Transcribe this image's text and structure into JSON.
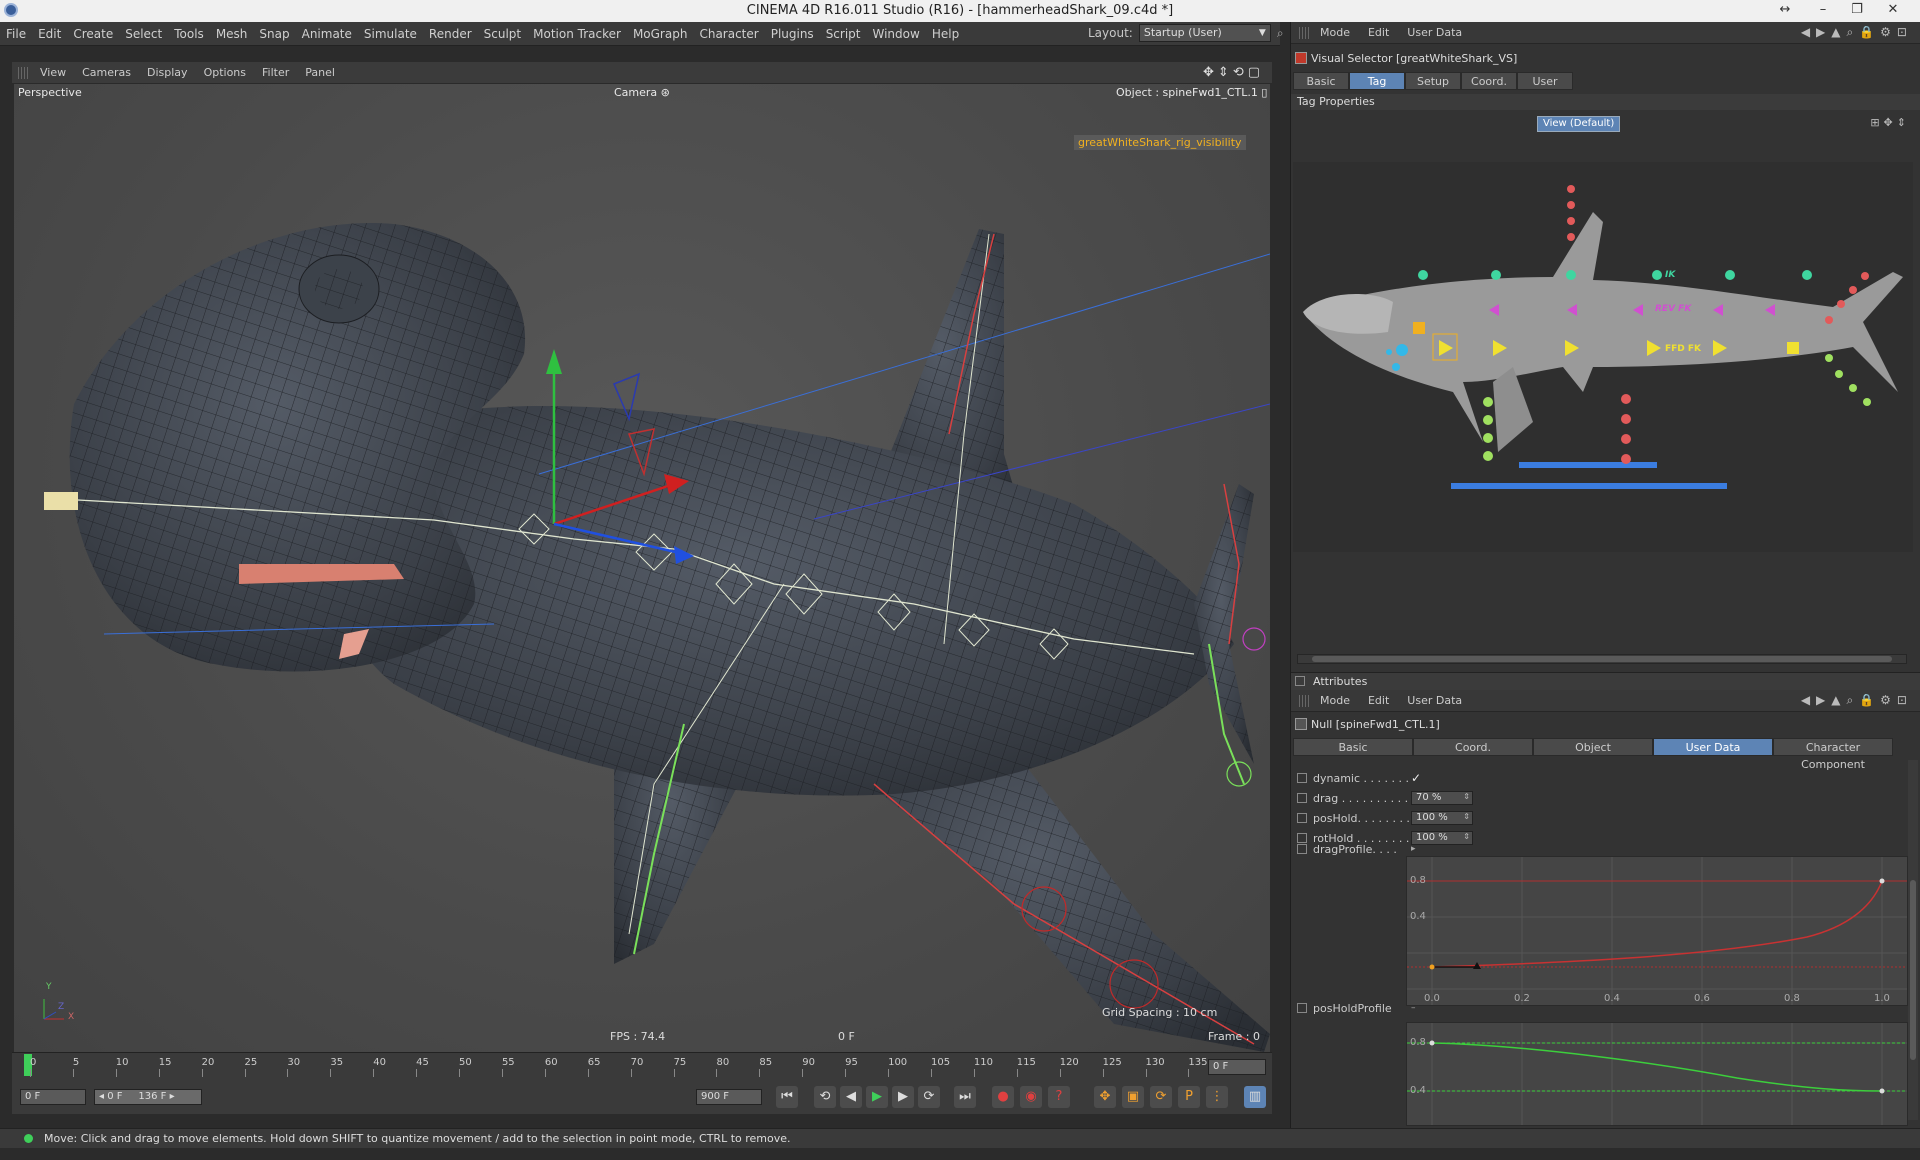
{
  "window": {
    "title": "CINEMA 4D R16.011 Studio (R16) - [hammerheadShark_09.c4d *]"
  },
  "main_menu": [
    "File",
    "Edit",
    "Create",
    "Select",
    "Tools",
    "Mesh",
    "Snap",
    "Animate",
    "Simulate",
    "Render",
    "Sculpt",
    "Motion Tracker",
    "MoGraph",
    "Character",
    "Plugins",
    "Script",
    "Window",
    "Help"
  ],
  "layout": {
    "label": "Layout:",
    "value": "Startup (User)"
  },
  "viewport": {
    "menu": [
      "View",
      "Cameras",
      "Display",
      "Options",
      "Filter",
      "Panel"
    ],
    "view_name": "Perspective",
    "camera": "Camera",
    "object_label": "Object : spineFwd1_CTL.1",
    "rig_tag": "greatWhiteShark_rig_visibility",
    "fps": "FPS : 74.4",
    "current_frame_center": "0 F",
    "grid_spacing": "Grid Spacing : 10 cm",
    "frame_label": "Frame : 0",
    "axis_y": "Y",
    "axis_z": "Z",
    "axis_x": "X"
  },
  "timeline": {
    "ticks": [
      "0",
      "5",
      "10",
      "15",
      "20",
      "25",
      "30",
      "35",
      "40",
      "45",
      "50",
      "55",
      "60",
      "65",
      "70",
      "75",
      "80",
      "85",
      "90",
      "95",
      "100",
      "105",
      "110",
      "115",
      "120",
      "125",
      "130",
      "135"
    ],
    "end_field": "0 F"
  },
  "playbar": {
    "start_field": "0 F",
    "range_start": "0 F",
    "range_end": "136 F",
    "max_field": "900 F"
  },
  "status": {
    "message": "Move: Click and drag to move elements. Hold down SHIFT to quantize movement / add to the selection in point mode, CTRL to remove."
  },
  "top_panel": {
    "menu": [
      "Mode",
      "Edit",
      "User Data"
    ],
    "object_title": "Visual Selector [greatWhiteShark_VS]",
    "tabs": [
      {
        "label": "Basic",
        "active": false
      },
      {
        "label": "Tag",
        "active": true
      },
      {
        "label": "Setup",
        "active": false
      },
      {
        "label": "Coord.",
        "active": false
      },
      {
        "label": "User Data",
        "active": false
      }
    ],
    "section": "Tag Properties",
    "view_button": "View (Default)",
    "selector_labels": {
      "ik": "IK",
      "rev_fk": "REV FK",
      "ffd_fk": "FFD FK"
    }
  },
  "attributes": {
    "header": "Attributes",
    "menu": [
      "Mode",
      "Edit",
      "User Data"
    ],
    "object_title": "Null [spineFwd1_CTL.1]",
    "tabs": [
      {
        "label": "Basic",
        "active": false
      },
      {
        "label": "Coord.",
        "active": false
      },
      {
        "label": "Object",
        "active": false
      },
      {
        "label": "User Data",
        "active": true
      },
      {
        "label": "Character Component",
        "active": false
      }
    ],
    "rows": [
      {
        "name": "dynamic . . . . . . . .",
        "value": "✓",
        "type": "check"
      },
      {
        "name": "drag . . . . . . . . . . .",
        "value": "70 %",
        "type": "field"
      },
      {
        "name": "posHold. . . . . . . .",
        "value": "100 %",
        "type": "field"
      },
      {
        "name": "rotHold . . . . . . . .",
        "value": "100 %",
        "type": "field"
      }
    ],
    "drag_profile_label": "dragProfile. . . .",
    "pos_hold_profile_label": "posHoldProfile",
    "graph_x_ticks": [
      "0.0",
      "0.2",
      "0.4",
      "0.6",
      "0.8",
      "1.0"
    ],
    "graph_y_ticks": [
      "0.8",
      "0.4"
    ],
    "graph2_y_ticks": [
      "0.8",
      "0.4"
    ],
    "colors": {
      "accent": "#5d84b5",
      "curve_red": "#c83232",
      "curve_green": "#3ccf3c"
    }
  }
}
